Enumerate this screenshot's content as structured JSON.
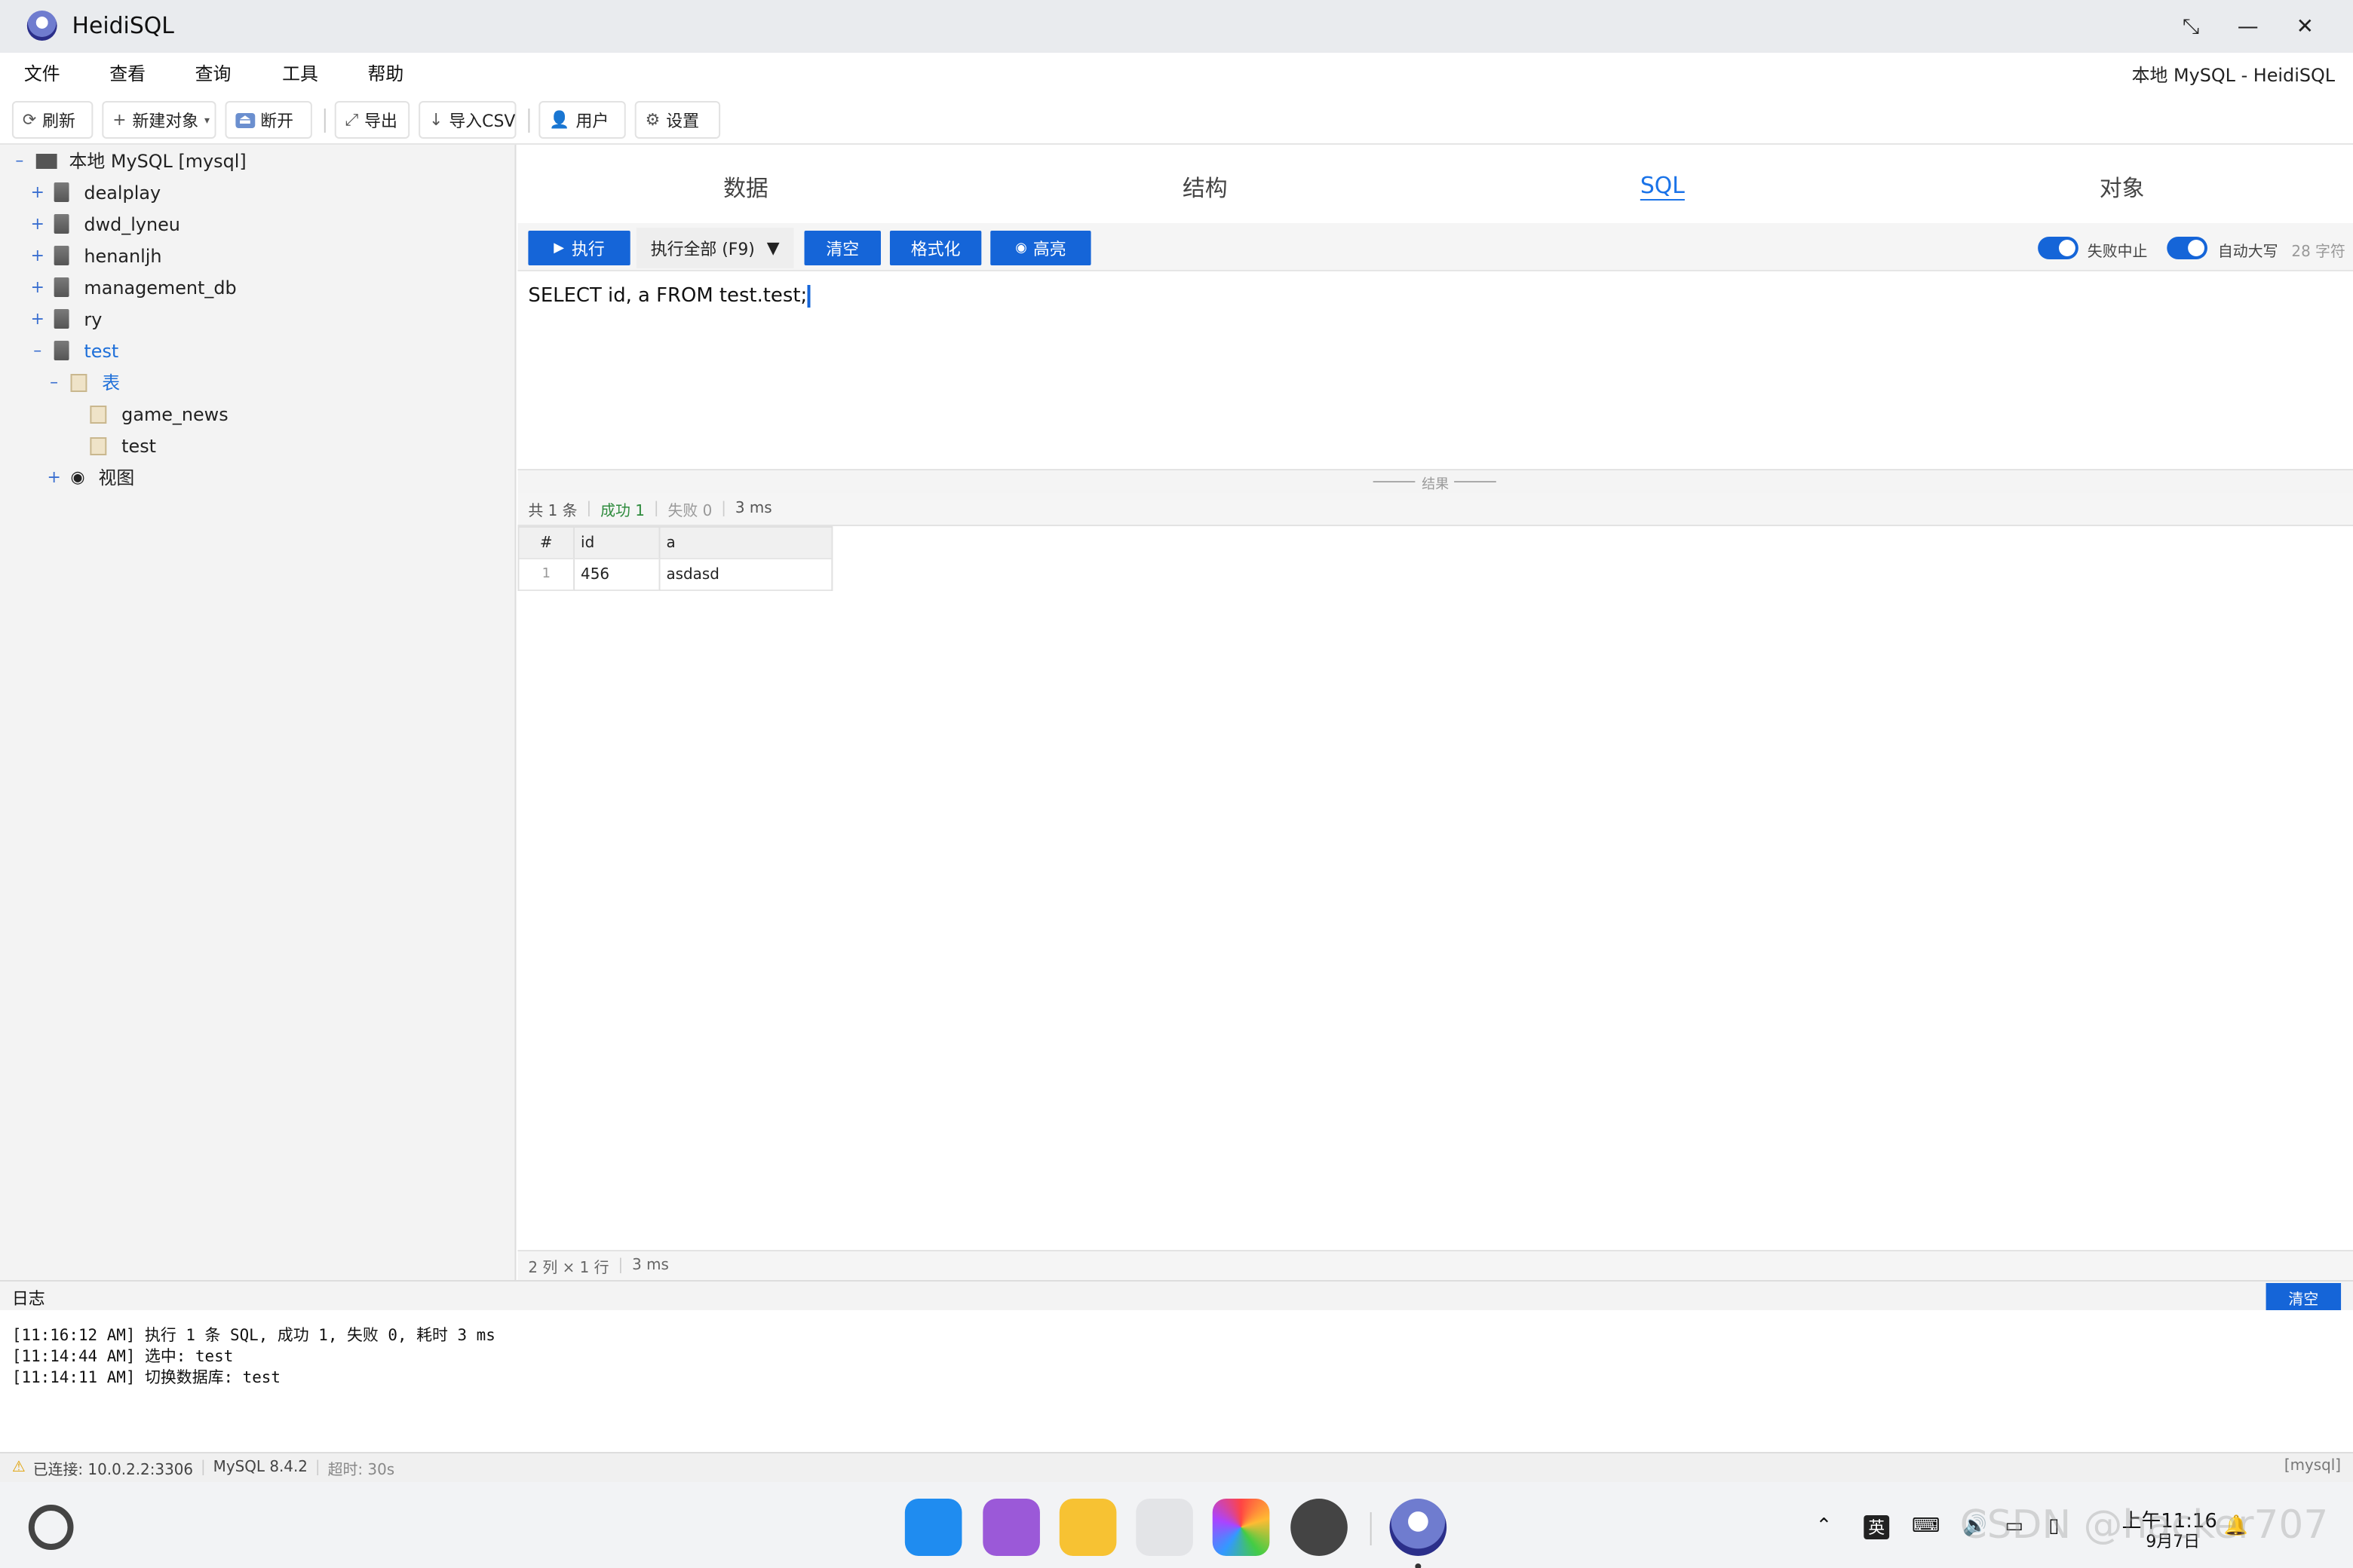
{
  "app": {
    "title": "HeidiSQL",
    "connection_title": "本地 MySQL - HeidiSQL"
  },
  "window": {
    "restore_glyph": "⤡",
    "minimize_glyph": "—",
    "close_glyph": "✕"
  },
  "menu": [
    "文件",
    "查看",
    "查询",
    "工具",
    "帮助"
  ],
  "toolbar": {
    "refresh": "刷新",
    "new_object": "新建对象",
    "disconnect": "断开",
    "export": "导出",
    "import_csv": "导入CSV",
    "users": "用户",
    "settings": "设置"
  },
  "sidebar": {
    "root": "本地 MySQL [mysql]",
    "databases": [
      "dealplay",
      "dwd_lyneu",
      "henanljh",
      "management_db",
      "ry",
      "test"
    ],
    "tables_folder": "表",
    "tables": [
      "game_news",
      "test"
    ],
    "views_folder": "视图"
  },
  "tabs": [
    "数据",
    "结构",
    "SQL",
    "对象"
  ],
  "active_tab": "SQL",
  "sqlbar": {
    "execute": "执行",
    "execute_all": "执行全部 (F9)",
    "clear": "清空",
    "format": "格式化",
    "highlight": "高亮",
    "stop_on_fail": "失败中止",
    "auto_upper": "自动大写",
    "char_count": "28 字符"
  },
  "editor": {
    "sql": "SELECT id, a FROM test.test;"
  },
  "splitter_label": "结果",
  "summary": {
    "total": "共 1 条",
    "success": "成功 1",
    "fail": "失败 0",
    "time": "3 ms"
  },
  "grid": {
    "columns": [
      "#",
      "id",
      "a"
    ],
    "rows": [
      [
        "1",
        "456",
        "asdasd"
      ]
    ]
  },
  "result_status": {
    "dims": "2 列 × 1 行",
    "time": "3 ms"
  },
  "log": {
    "title": "日志",
    "clear": "清空",
    "lines": [
      "[11:16:12 AM] 执行 1 条 SQL, 成功 1, 失败 0, 耗时 3 ms",
      "[11:14:44 AM] 选中: test",
      "[11:14:11 AM] 切换数据库: test"
    ]
  },
  "status": {
    "connected": "已连接: 10.0.2.2:3306",
    "version": "MySQL 8.4.2",
    "timeout": "超时: 30s",
    "db": "[mysql]"
  },
  "taskbar": {
    "ime": "英",
    "time": "上午11:16",
    "date": "9月7日",
    "watermark": "CSDN @hacker707"
  },
  "colors": {
    "accent": "#1565d8",
    "success": "#2e8b3d"
  }
}
